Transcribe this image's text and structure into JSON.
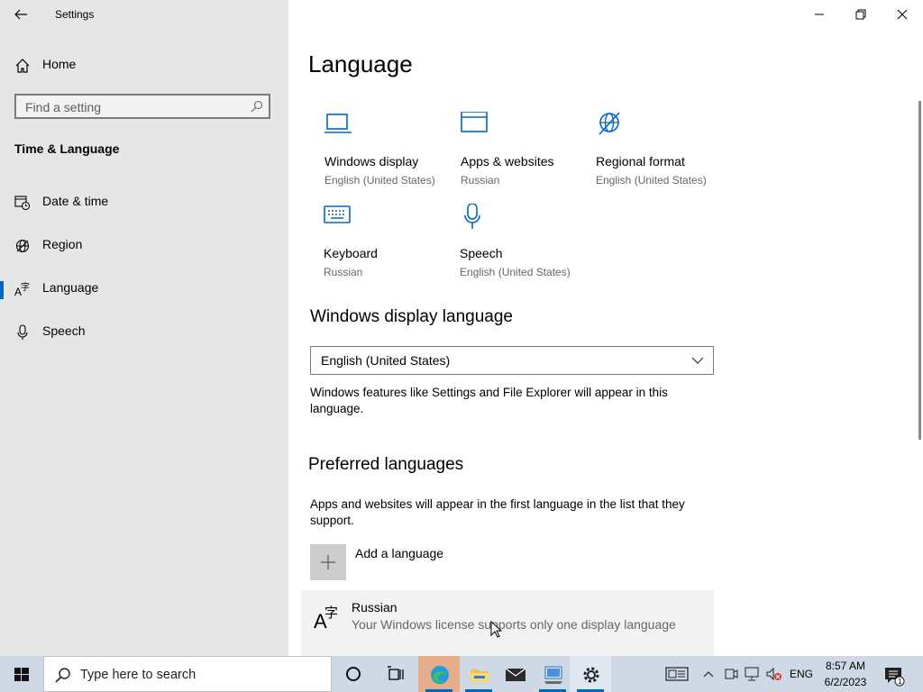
{
  "window": {
    "title": "Settings"
  },
  "sidebar": {
    "home_label": "Home",
    "search_placeholder": "Find a setting",
    "section_title": "Time & Language",
    "items": [
      {
        "label": "Date & time",
        "icon": "calendar-clock-icon"
      },
      {
        "label": "Region",
        "icon": "globe-icon"
      },
      {
        "label": "Language",
        "icon": "language-icon",
        "active": true
      },
      {
        "label": "Speech",
        "icon": "microphone-icon"
      }
    ]
  },
  "main": {
    "title": "Language",
    "tiles": [
      {
        "name": "Windows display",
        "sub": "English (United States)",
        "icon": "laptop-icon"
      },
      {
        "name": "Apps & websites",
        "sub": "Russian",
        "icon": "browser-window-icon"
      },
      {
        "name": "Regional format",
        "sub": "English (United States)",
        "icon": "globe-icon"
      },
      {
        "name": "Keyboard",
        "sub": "Russian",
        "icon": "keyboard-icon"
      },
      {
        "name": "Speech",
        "sub": "English (United States)",
        "icon": "microphone-icon"
      }
    ],
    "display_language": {
      "heading": "Windows display language",
      "selected": "English (United States)",
      "note": "Windows features like Settings and File Explorer will appear in this language."
    },
    "preferred": {
      "heading": "Preferred languages",
      "note": "Apps and websites will appear in the first language in the list that they support.",
      "add_label": "Add a language",
      "languages": [
        {
          "name": "Russian",
          "note": "Your Windows license supports only one display language"
        }
      ]
    }
  },
  "taskbar": {
    "search_placeholder": "Type here to search",
    "apps": [
      "cortana-icon",
      "task-view-icon",
      "edge-icon",
      "file-explorer-icon",
      "mail-icon",
      "network-app-icon",
      "settings-icon"
    ],
    "language": "ENG",
    "time": "8:57 AM",
    "date": "6/2/2023"
  },
  "colors": {
    "accent": "#0067c0",
    "sidebar_bg": "#e6e6e6",
    "taskbar_bg": "#cfd9e6"
  }
}
